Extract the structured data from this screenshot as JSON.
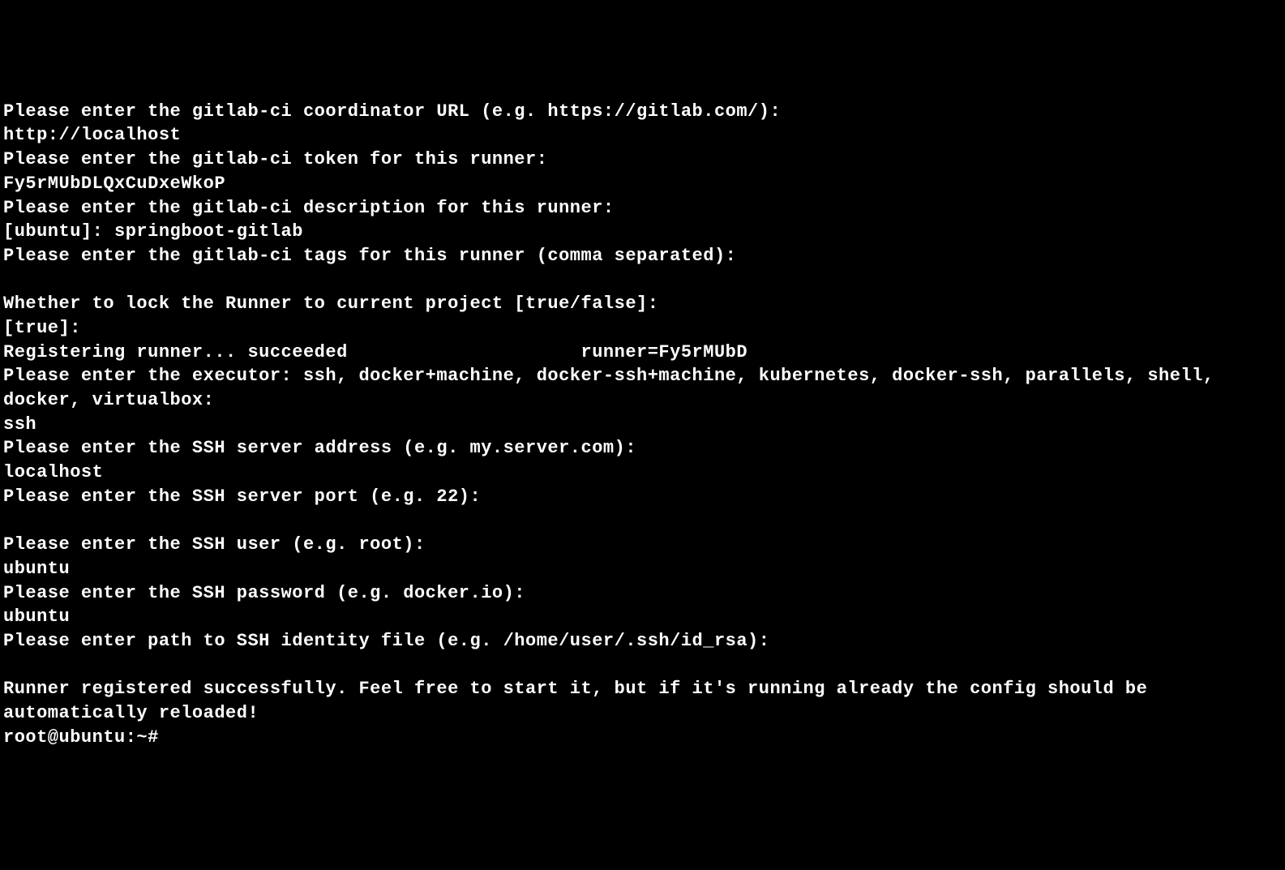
{
  "terminal": {
    "lines": [
      "Please enter the gitlab-ci coordinator URL (e.g. https://gitlab.com/):",
      "http://localhost",
      "Please enter the gitlab-ci token for this runner:",
      "Fy5rMUbDLQxCuDxeWkoP",
      "Please enter the gitlab-ci description for this runner:",
      "[ubuntu]: springboot-gitlab",
      "Please enter the gitlab-ci tags for this runner (comma separated):",
      "",
      "Whether to lock the Runner to current project [true/false]:",
      "[true]:",
      "Registering runner... succeeded                     runner=Fy5rMUbD",
      "Please enter the executor: ssh, docker+machine, docker-ssh+machine, kubernetes, docker-ssh, parallels, shell, docker, virtualbox:",
      "ssh",
      "Please enter the SSH server address (e.g. my.server.com):",
      "localhost",
      "Please enter the SSH server port (e.g. 22):",
      "",
      "Please enter the SSH user (e.g. root):",
      "ubuntu",
      "Please enter the SSH password (e.g. docker.io):",
      "ubuntu",
      "Please enter path to SSH identity file (e.g. /home/user/.ssh/id_rsa):",
      "",
      "Runner registered successfully. Feel free to start it, but if it's running already the config should be automatically reloaded!"
    ],
    "prompt": "root@ubuntu:~# "
  }
}
